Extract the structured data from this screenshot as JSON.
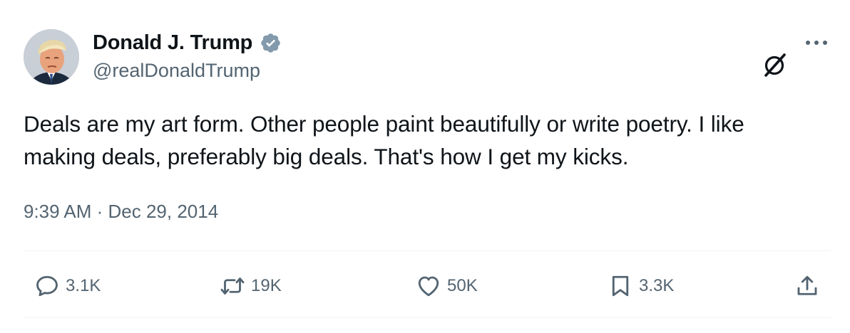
{
  "author": {
    "display_name": "Donald J. Trump",
    "handle": "@realDonaldTrump",
    "verified": true,
    "verified_color": "#829aab"
  },
  "tweet": {
    "text": "Deals are my art form. Other people paint beautifully or write poetry. I like making deals, preferably big deals. That's how I get my kicks.",
    "timestamp": "9:39 AM · Dec 29, 2014"
  },
  "header_icons": {
    "grok": "grok-icon",
    "more": "more-icon"
  },
  "actions": {
    "reply": {
      "icon": "reply-icon",
      "count": "3.1K"
    },
    "retweet": {
      "icon": "retweet-icon",
      "count": "19K"
    },
    "like": {
      "icon": "heart-icon",
      "count": "50K"
    },
    "bookmark": {
      "icon": "bookmark-icon",
      "count": "3.3K"
    },
    "share": {
      "icon": "share-icon"
    }
  },
  "colors": {
    "text_primary": "#0f1419",
    "text_secondary": "#536471",
    "divider": "#eff3f4"
  }
}
